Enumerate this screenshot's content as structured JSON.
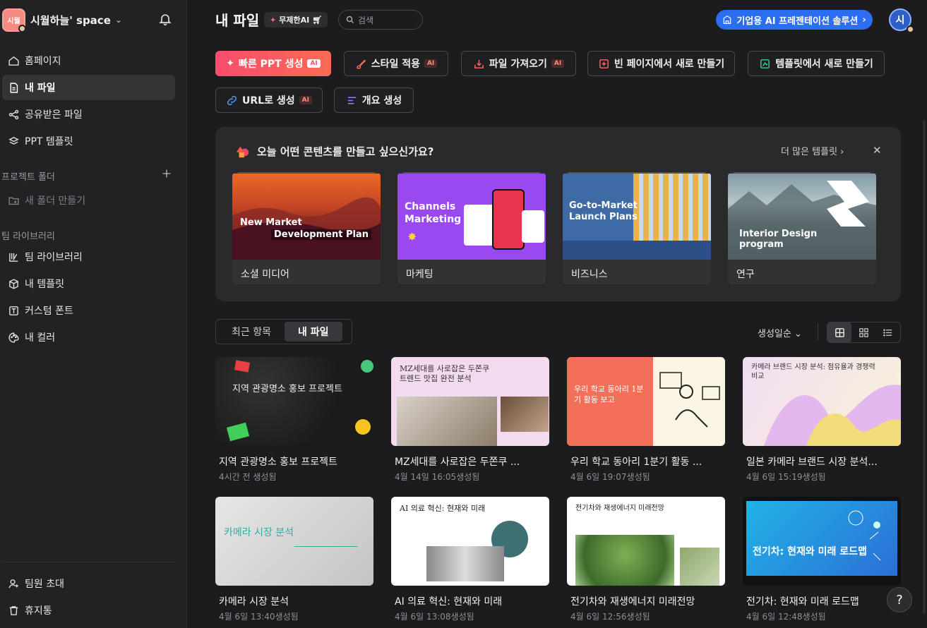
{
  "sidebar": {
    "workspace_avatar": "시월",
    "workspace_name": "시월하늘' space",
    "nav": [
      {
        "label": "홈페이지",
        "icon": "home-icon"
      },
      {
        "label": "내 파일",
        "icon": "file-icon",
        "active": true
      },
      {
        "label": "공유받은 파일",
        "icon": "share-icon"
      },
      {
        "label": "PPT 템플릿",
        "icon": "template-icon"
      }
    ],
    "project_folder_title": "프로젝트 폴더",
    "new_folder": "새 폴더 만들기",
    "team_library_title": "팀 라이브러리",
    "team": [
      {
        "label": "팀 라이브러리",
        "icon": "library-icon"
      },
      {
        "label": "내 템플릿",
        "icon": "cube-icon"
      },
      {
        "label": "커스텀 폰트",
        "icon": "font-icon"
      },
      {
        "label": "내 컬러",
        "icon": "palette-icon"
      }
    ],
    "bottom": [
      {
        "label": "팀원 초대",
        "icon": "invite-icon"
      },
      {
        "label": "휴지통",
        "icon": "trash-icon"
      }
    ]
  },
  "header": {
    "title": "내 파일",
    "unlimited_badge": "무제한AI",
    "search_placeholder": "검색",
    "enterprise_button": "기업용 AI 프레젠테이션 솔루션",
    "user_avatar": "시"
  },
  "actions": [
    {
      "label": "빠른 PPT 생성",
      "ai": "AI",
      "primary": true
    },
    {
      "label": "스타일 적용",
      "ai": "AI"
    },
    {
      "label": "파일 가져오기",
      "ai": "AI"
    },
    {
      "label": "빈 페이지에서 새로 만들기"
    },
    {
      "label": "템플릿에서 새로 만들기"
    },
    {
      "label": "URL로 생성",
      "ai": "AI"
    },
    {
      "label": "개요 생성"
    }
  ],
  "panel": {
    "title": "오늘 어떤 콘텐츠를 만들고 싶으신가요?",
    "more_templates": "더 많은 템플릿",
    "templates": [
      {
        "label": "소셜 미디어",
        "title_a": "New Market",
        "title_b": "Development Plan"
      },
      {
        "label": "마케팅",
        "title_a": "Channels",
        "title_b": "Marketing"
      },
      {
        "label": "비즈니스",
        "title_a": "Go-to-Market",
        "title_b": "Launch Plans"
      },
      {
        "label": "연구",
        "title_a": "Interior Design",
        "title_b": "program"
      }
    ]
  },
  "tabs": [
    {
      "label": "최근 항목"
    },
    {
      "label": "내 파일",
      "active": true
    }
  ],
  "sort_label": "생성일순",
  "files": [
    {
      "name": "지역 관광명소 홍보 프로젝트",
      "date": "4시간 전 생성됨",
      "thumb_text": "지역 관광명소 홍보 프로젝트"
    },
    {
      "name": "MZ세대를 사로잡은 두쫀쿠 ...",
      "date": "4월 14일 16:05생성됨",
      "thumb_text": "MZ세대를 사로잡은 두쫀쿠 트렌드 맛집 완전 분석"
    },
    {
      "name": "우리 학교 동아리 1분기 활동 ...",
      "date": "4월 6일 19:07생성됨",
      "thumb_text": "우리 학교 동아리 1분기 활동 보고"
    },
    {
      "name": "일본 카메라 브랜드 시장 분석...",
      "date": "4월 6일 15:19생성됨",
      "thumb_text": "카메라 브랜드 시장 분석: 점유율과 경쟁력 비교"
    },
    {
      "name": "카메라 시장 분석",
      "date": "4월 6일 13:40생성됨",
      "thumb_text": "카메라 시장 분석"
    },
    {
      "name": "AI 의료 혁신: 현재와 미래",
      "date": "4월 6일 13:08생성됨",
      "thumb_text": "AI 의료 혁신: 현재와 미래"
    },
    {
      "name": "전기차와 재생에너지 미래전망",
      "date": "4월 6일 12:56생성됨",
      "thumb_text": "전기차와 재생에너지 미래전망"
    },
    {
      "name": "전기차: 현재와 미래 로드맵",
      "date": "4월 6일 12:48생성됨",
      "thumb_text": "전기차: 현재와 미래 로드맵"
    }
  ],
  "help": "?"
}
